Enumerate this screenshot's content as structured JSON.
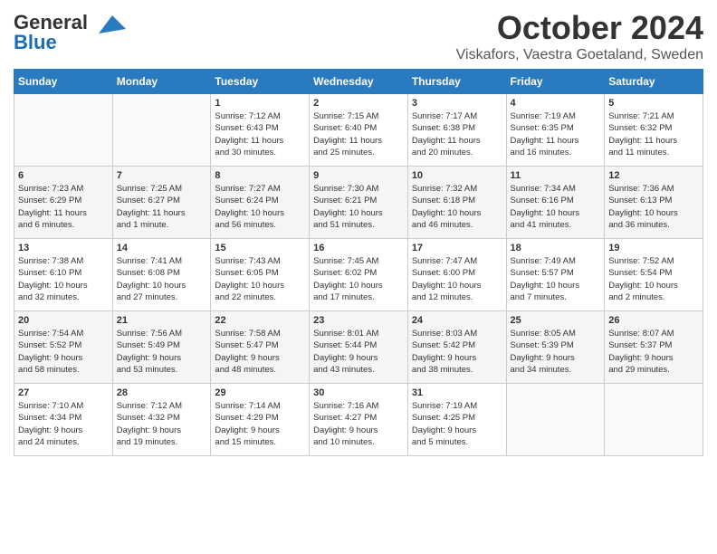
{
  "header": {
    "logo_general": "General",
    "logo_blue": "Blue",
    "title": "October 2024",
    "subtitle": "Viskafors, Vaestra Goetaland, Sweden"
  },
  "calendar": {
    "weekdays": [
      "Sunday",
      "Monday",
      "Tuesday",
      "Wednesday",
      "Thursday",
      "Friday",
      "Saturday"
    ],
    "weeks": [
      [
        {
          "day": "",
          "content": ""
        },
        {
          "day": "",
          "content": ""
        },
        {
          "day": "1",
          "content": "Sunrise: 7:12 AM\nSunset: 6:43 PM\nDaylight: 11 hours\nand 30 minutes."
        },
        {
          "day": "2",
          "content": "Sunrise: 7:15 AM\nSunset: 6:40 PM\nDaylight: 11 hours\nand 25 minutes."
        },
        {
          "day": "3",
          "content": "Sunrise: 7:17 AM\nSunset: 6:38 PM\nDaylight: 11 hours\nand 20 minutes."
        },
        {
          "day": "4",
          "content": "Sunrise: 7:19 AM\nSunset: 6:35 PM\nDaylight: 11 hours\nand 16 minutes."
        },
        {
          "day": "5",
          "content": "Sunrise: 7:21 AM\nSunset: 6:32 PM\nDaylight: 11 hours\nand 11 minutes."
        }
      ],
      [
        {
          "day": "6",
          "content": "Sunrise: 7:23 AM\nSunset: 6:29 PM\nDaylight: 11 hours\nand 6 minutes."
        },
        {
          "day": "7",
          "content": "Sunrise: 7:25 AM\nSunset: 6:27 PM\nDaylight: 11 hours\nand 1 minute."
        },
        {
          "day": "8",
          "content": "Sunrise: 7:27 AM\nSunset: 6:24 PM\nDaylight: 10 hours\nand 56 minutes."
        },
        {
          "day": "9",
          "content": "Sunrise: 7:30 AM\nSunset: 6:21 PM\nDaylight: 10 hours\nand 51 minutes."
        },
        {
          "day": "10",
          "content": "Sunrise: 7:32 AM\nSunset: 6:18 PM\nDaylight: 10 hours\nand 46 minutes."
        },
        {
          "day": "11",
          "content": "Sunrise: 7:34 AM\nSunset: 6:16 PM\nDaylight: 10 hours\nand 41 minutes."
        },
        {
          "day": "12",
          "content": "Sunrise: 7:36 AM\nSunset: 6:13 PM\nDaylight: 10 hours\nand 36 minutes."
        }
      ],
      [
        {
          "day": "13",
          "content": "Sunrise: 7:38 AM\nSunset: 6:10 PM\nDaylight: 10 hours\nand 32 minutes."
        },
        {
          "day": "14",
          "content": "Sunrise: 7:41 AM\nSunset: 6:08 PM\nDaylight: 10 hours\nand 27 minutes."
        },
        {
          "day": "15",
          "content": "Sunrise: 7:43 AM\nSunset: 6:05 PM\nDaylight: 10 hours\nand 22 minutes."
        },
        {
          "day": "16",
          "content": "Sunrise: 7:45 AM\nSunset: 6:02 PM\nDaylight: 10 hours\nand 17 minutes."
        },
        {
          "day": "17",
          "content": "Sunrise: 7:47 AM\nSunset: 6:00 PM\nDaylight: 10 hours\nand 12 minutes."
        },
        {
          "day": "18",
          "content": "Sunrise: 7:49 AM\nSunset: 5:57 PM\nDaylight: 10 hours\nand 7 minutes."
        },
        {
          "day": "19",
          "content": "Sunrise: 7:52 AM\nSunset: 5:54 PM\nDaylight: 10 hours\nand 2 minutes."
        }
      ],
      [
        {
          "day": "20",
          "content": "Sunrise: 7:54 AM\nSunset: 5:52 PM\nDaylight: 9 hours\nand 58 minutes."
        },
        {
          "day": "21",
          "content": "Sunrise: 7:56 AM\nSunset: 5:49 PM\nDaylight: 9 hours\nand 53 minutes."
        },
        {
          "day": "22",
          "content": "Sunrise: 7:58 AM\nSunset: 5:47 PM\nDaylight: 9 hours\nand 48 minutes."
        },
        {
          "day": "23",
          "content": "Sunrise: 8:01 AM\nSunset: 5:44 PM\nDaylight: 9 hours\nand 43 minutes."
        },
        {
          "day": "24",
          "content": "Sunrise: 8:03 AM\nSunset: 5:42 PM\nDaylight: 9 hours\nand 38 minutes."
        },
        {
          "day": "25",
          "content": "Sunrise: 8:05 AM\nSunset: 5:39 PM\nDaylight: 9 hours\nand 34 minutes."
        },
        {
          "day": "26",
          "content": "Sunrise: 8:07 AM\nSunset: 5:37 PM\nDaylight: 9 hours\nand 29 minutes."
        }
      ],
      [
        {
          "day": "27",
          "content": "Sunrise: 7:10 AM\nSunset: 4:34 PM\nDaylight: 9 hours\nand 24 minutes."
        },
        {
          "day": "28",
          "content": "Sunrise: 7:12 AM\nSunset: 4:32 PM\nDaylight: 9 hours\nand 19 minutes."
        },
        {
          "day": "29",
          "content": "Sunrise: 7:14 AM\nSunset: 4:29 PM\nDaylight: 9 hours\nand 15 minutes."
        },
        {
          "day": "30",
          "content": "Sunrise: 7:16 AM\nSunset: 4:27 PM\nDaylight: 9 hours\nand 10 minutes."
        },
        {
          "day": "31",
          "content": "Sunrise: 7:19 AM\nSunset: 4:25 PM\nDaylight: 9 hours\nand 5 minutes."
        },
        {
          "day": "",
          "content": ""
        },
        {
          "day": "",
          "content": ""
        }
      ]
    ]
  }
}
